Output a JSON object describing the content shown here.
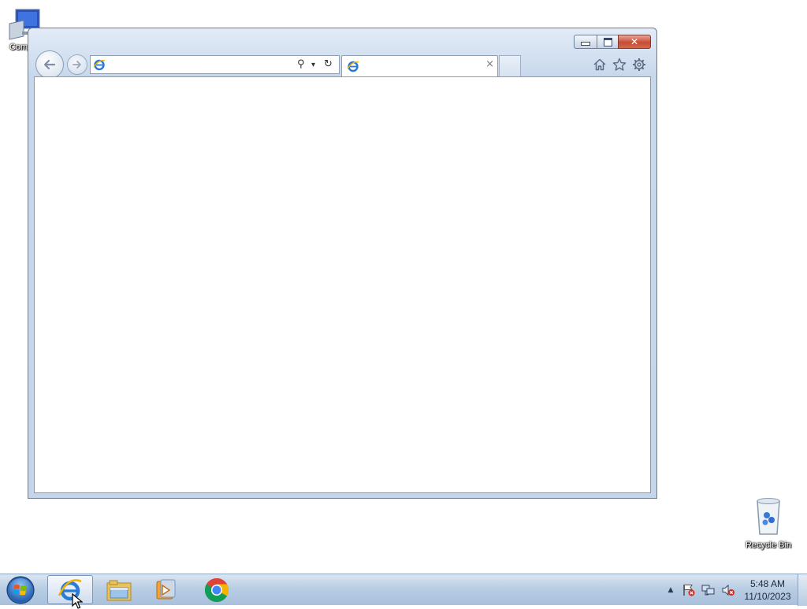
{
  "desktop": {
    "icons": [
      {
        "label": "Comp"
      },
      {
        "label": "Recycle Bin"
      }
    ]
  },
  "browser": {
    "address": {
      "value": "",
      "placeholder": ""
    },
    "tab": {
      "title": "",
      "close_glyph": "×"
    },
    "caption": {
      "close_glyph": "✕"
    },
    "nav": {
      "search_glyph": "⚲",
      "dropdown_glyph": "▾",
      "refresh_glyph": "↻"
    }
  },
  "taskbar": {
    "apps": [
      {
        "name": "internet-explorer",
        "active": true
      },
      {
        "name": "windows-explorer"
      },
      {
        "name": "windows-media-player"
      },
      {
        "name": "google-chrome"
      }
    ],
    "tray": {
      "show_hidden_glyph": "▲"
    },
    "clock": {
      "time": "5:48 AM",
      "date": "11/10/2023"
    }
  }
}
